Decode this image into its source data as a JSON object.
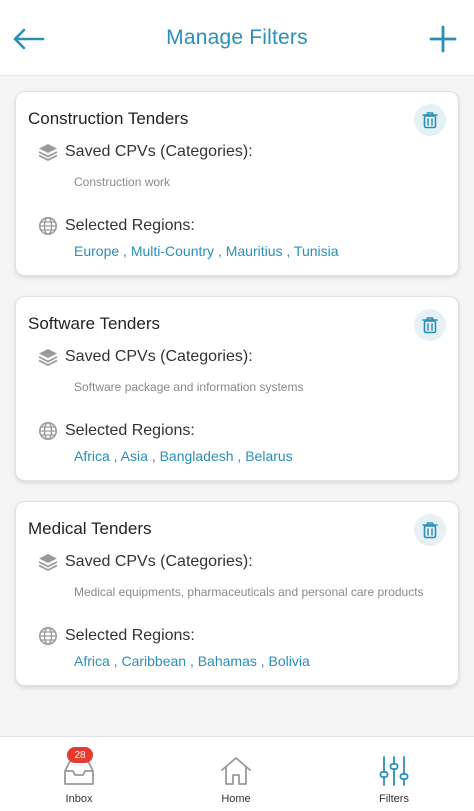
{
  "header": {
    "title": "Manage Filters"
  },
  "labels": {
    "cpv_heading": "Saved CPVs (Categories):",
    "regions_heading": "Selected Regions:"
  },
  "filters": [
    {
      "title": "Construction Tenders",
      "cpv": "Construction work",
      "regions": "Europe , Multi-Country , Mauritius , Tunisia"
    },
    {
      "title": "Software Tenders",
      "cpv": "Software package and information systems",
      "regions": "Africa , Asia , Bangladesh , Belarus"
    },
    {
      "title": "Medical Tenders",
      "cpv": "Medical equipments, pharmaceuticals and personal care products",
      "regions": "Africa , Caribbean , Bahamas , Bolivia"
    }
  ],
  "nav": {
    "inbox_label": "Inbox",
    "inbox_badge": "28",
    "home_label": "Home",
    "filters_label": "Filters"
  },
  "colors": {
    "accent": "#2a8fb8",
    "badge": "#e63a2e",
    "icon_grey": "#9a9a9a"
  }
}
